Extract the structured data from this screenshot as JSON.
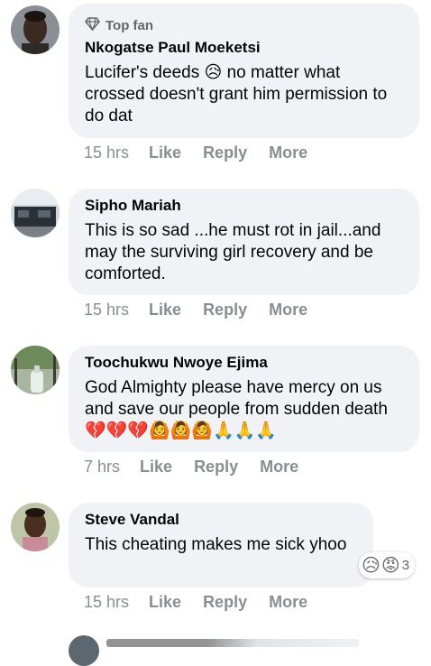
{
  "comments": [
    {
      "badge": "Top fan",
      "name": "Nkogatse Paul Moeketsi",
      "text": "Lucifer's deeds 😥 no matter what crossed doesn't grant him permission to do dat",
      "time": "15 hrs",
      "like": "Like",
      "reply": "Reply",
      "more": "More"
    },
    {
      "name": "Sipho Mariah",
      "text": "This is so sad ...he must rot in jail...and may the surviving girl recovery and be comforted.",
      "time": "15 hrs",
      "like": "Like",
      "reply": "Reply",
      "more": "More"
    },
    {
      "name": "Toochukwu Nwoye Ejima",
      "text": "God Almighty please have mercy on us and save our people from sudden death 💔💔💔🙆🙆🙆🙏🙏🙏",
      "time": "7 hrs",
      "like": "Like",
      "reply": "Reply",
      "more": "More"
    },
    {
      "name": "Steve Vandal",
      "text": "This cheating makes me sick yhoo",
      "time": "15 hrs",
      "like": "Like",
      "reply": "Reply",
      "more": "More",
      "reactions": {
        "emojis": "😥😡",
        "count": "3"
      }
    }
  ],
  "colors": {
    "bubble": "#f0f2f5",
    "action_gray": "#8a8d91",
    "badge_gray": "#65676b"
  }
}
